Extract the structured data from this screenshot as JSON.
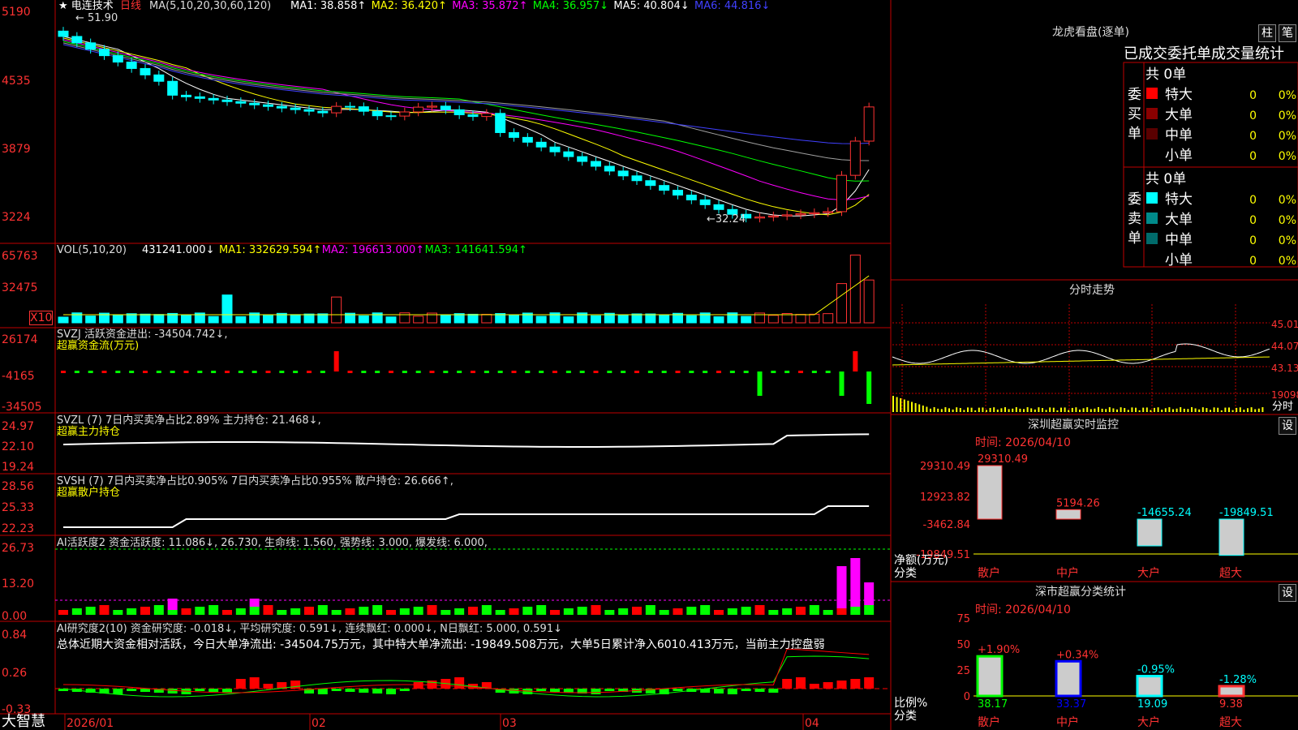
{
  "chart_data": {
    "type": "candlestick",
    "title": "电连技术",
    "subtitle": "日线",
    "ylim": [
      3224,
      5190
    ],
    "y_ticks": [
      "5190",
      "4535",
      "3879",
      "3224"
    ],
    "price_annotations": {
      "high": "51.90",
      "low": "32.24"
    },
    "x_ticks": [
      "2026/01",
      "02",
      "03",
      "04"
    ],
    "ma_legend": {
      "label": "MA(5,10,20,30,60,120)",
      "items": [
        "MA1: 38.858↑",
        "MA2: 36.420↑",
        "MA3: 35.872↑",
        "MA4: 36.957↓",
        "MA5: 40.804↓",
        "MA6: 44.816↓"
      ]
    },
    "panels": [
      {
        "name": "VOL",
        "legend": "VOL(5,10,20)",
        "value": "431241.000↓",
        "items": [
          "MA1: 332629.594↑",
          "MA2: 196613.000↑",
          "MA3: 141641.594↑"
        ],
        "y_ticks": [
          "65763",
          "32475"
        ],
        "unit": "X10"
      },
      {
        "name": "SVZJ",
        "legend": "SVZJ  活跃资金进出: -34504.742↓,",
        "sub": "超赢资金流(万元)",
        "y_ticks": [
          "26174",
          "-4165",
          "-34505"
        ]
      },
      {
        "name": "SVZL",
        "legend": "SVZL (7) 7日内买卖净占比2.89% 主力持仓: 21.468↓,",
        "sub": "超赢主力持仓",
        "y_ticks": [
          "24.97",
          "22.10",
          "19.24"
        ]
      },
      {
        "name": "SVSH",
        "legend": "SVSH (7) 7日内买卖净占比0.905% 7日内买卖净占比0.955% 散户持仓: 26.666↑,",
        "sub": "超赢散户持仓",
        "y_ticks": [
          "28.56",
          "25.33",
          "22.23"
        ]
      },
      {
        "name": "AI活跃度2",
        "legend": "AI活跃度2 资金活跃度: 11.086↓, 26.730, 生命线: 1.560, 强势线: 3.000, 爆发线: 6.000,",
        "y_ticks": [
          "26.73",
          "13.20",
          "0.00"
        ]
      },
      {
        "name": "AI研究度2",
        "legend": "AI研究度2(10) 资金研究度: -0.018↓, 平均研究度: 0.591↓, 连续飘红: 0.000↓, N日飘红: 5.000, 0.591↓",
        "note": "总体近期大资金相对活跃，今日大单净流出: -34504.75万元，其中特大单净流出: -19849.508万元，大单5日累计净入6010.413万元，当前主力控盘弱",
        "y_ticks": [
          "0.84",
          "0.26",
          "-0.33"
        ]
      }
    ]
  },
  "brand": "大智慧",
  "right": {
    "lhb_title": "龙虎看盘(逐单)",
    "btn1": "柱",
    "btn2": "笔",
    "stat_title": "已成交委托单成交量统计",
    "buy": {
      "side": "委买单",
      "total": "共 0单",
      "rows": [
        {
          "name": "特大",
          "n": "0",
          "p": "0%",
          "color": "#ff0000"
        },
        {
          "name": "大单",
          "n": "0",
          "p": "0%",
          "color": "#8a0000"
        },
        {
          "name": "中单",
          "n": "0",
          "p": "0%",
          "color": "#5a0000"
        },
        {
          "name": "小单",
          "n": "0",
          "p": "0%",
          "color": "#000"
        }
      ]
    },
    "sell": {
      "side": "委卖单",
      "total": "共 0单",
      "rows": [
        {
          "name": "特大",
          "n": "0",
          "p": "0%",
          "color": "#00ffff"
        },
        {
          "name": "大单",
          "n": "0",
          "p": "0%",
          "color": "#008a8a"
        },
        {
          "name": "中单",
          "n": "0",
          "p": "0%",
          "color": "#006a6a"
        },
        {
          "name": "小单",
          "n": "0",
          "p": "0%",
          "color": "#000"
        }
      ]
    },
    "fs_title": "分时走势",
    "fs_ticks": [
      "45.01",
      "44.07",
      "43.13",
      "19098"
    ],
    "fs_unit": "分时",
    "mon_title": "深圳超赢实时监控",
    "mon_set": "设",
    "mon_time": "时间: 2026/04/10",
    "mon_y": [
      "29310.49",
      "12923.82",
      "-3462.84",
      "-19849.51"
    ],
    "mon_axis": "净额(万元)",
    "mon_axis2": "分类",
    "mon_cats": [
      "散户",
      "中户",
      "大户",
      "超大"
    ],
    "mon_vals": [
      29310.49,
      5194.26,
      -14655.24,
      -19849.51
    ],
    "mon_labels": [
      "29310.49",
      "5194.26",
      "-14655.24",
      "-19849.51"
    ],
    "cls_title": "深市超赢分类统计",
    "cls_set": "设",
    "cls_time": "时间: 2026/04/10",
    "cls_y": [
      "75",
      "50",
      "25",
      "0"
    ],
    "cls_axis": "比例%",
    "cls_axis2": "分类",
    "cls_pct": [
      38.17,
      33.37,
      19.09,
      9.38
    ],
    "cls_pct_labels": [
      "38.17",
      "33.37",
      "19.09",
      "9.38"
    ],
    "cls_chg": [
      "+1.90%",
      "+0.34%",
      "-0.95%",
      "-1.28%"
    ]
  }
}
